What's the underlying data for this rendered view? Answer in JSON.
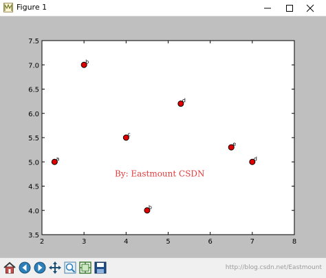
{
  "window": {
    "title": "Figure 1",
    "minimize_icon": "minimize-icon",
    "maximize_icon": "maximize-icon",
    "close_icon": "close-icon"
  },
  "colors": {
    "background": "#bfbfbf",
    "marker_fill": "#e00000",
    "annotation": "#e33b3b"
  },
  "chart_data": {
    "type": "scatter",
    "title": "",
    "xlabel": "",
    "ylabel": "",
    "xlim": [
      2,
      8
    ],
    "ylim": [
      3.5,
      7.5
    ],
    "xticks": [
      "2",
      "3",
      "4",
      "5",
      "6",
      "7",
      "8"
    ],
    "yticks": [
      "3.5",
      "4.0",
      "4.5",
      "5.0",
      "5.5",
      "6.0",
      "6.5",
      "7.0",
      "7.5"
    ],
    "xtick_values": [
      2,
      3,
      4,
      5,
      6,
      7,
      8
    ],
    "ytick_values": [
      3.5,
      4.0,
      4.5,
      5.0,
      5.5,
      6.0,
      6.5,
      7.0,
      7.5
    ],
    "grid": false,
    "points": [
      {
        "x": 2.3,
        "y": 5.0,
        "label": "a"
      },
      {
        "x": 3.0,
        "y": 7.0,
        "label": "b"
      },
      {
        "x": 4.0,
        "y": 5.5,
        "label": "c"
      },
      {
        "x": 4.5,
        "y": 4.0,
        "label": "b"
      },
      {
        "x": 5.3,
        "y": 6.2,
        "label": "d"
      },
      {
        "x": 6.5,
        "y": 5.3,
        "label": "e"
      },
      {
        "x": 7.0,
        "y": 5.0,
        "label": "d"
      }
    ],
    "annotation": {
      "text": "By: Eastmount CSDN",
      "x": 4.8,
      "y": 4.7
    }
  },
  "toolbar": {
    "buttons": [
      {
        "name": "home-button",
        "icon": "home-icon"
      },
      {
        "name": "back-button",
        "icon": "back-arrow-icon"
      },
      {
        "name": "forward-button",
        "icon": "forward-arrow-icon"
      },
      {
        "name": "pan-button",
        "icon": "move-icon"
      },
      {
        "name": "zoom-button",
        "icon": "zoom-icon"
      },
      {
        "name": "subplots-button",
        "icon": "subplots-icon"
      },
      {
        "name": "save-button",
        "icon": "save-icon"
      }
    ],
    "watermark": "http://blog.csdn.net/Eastmount"
  }
}
